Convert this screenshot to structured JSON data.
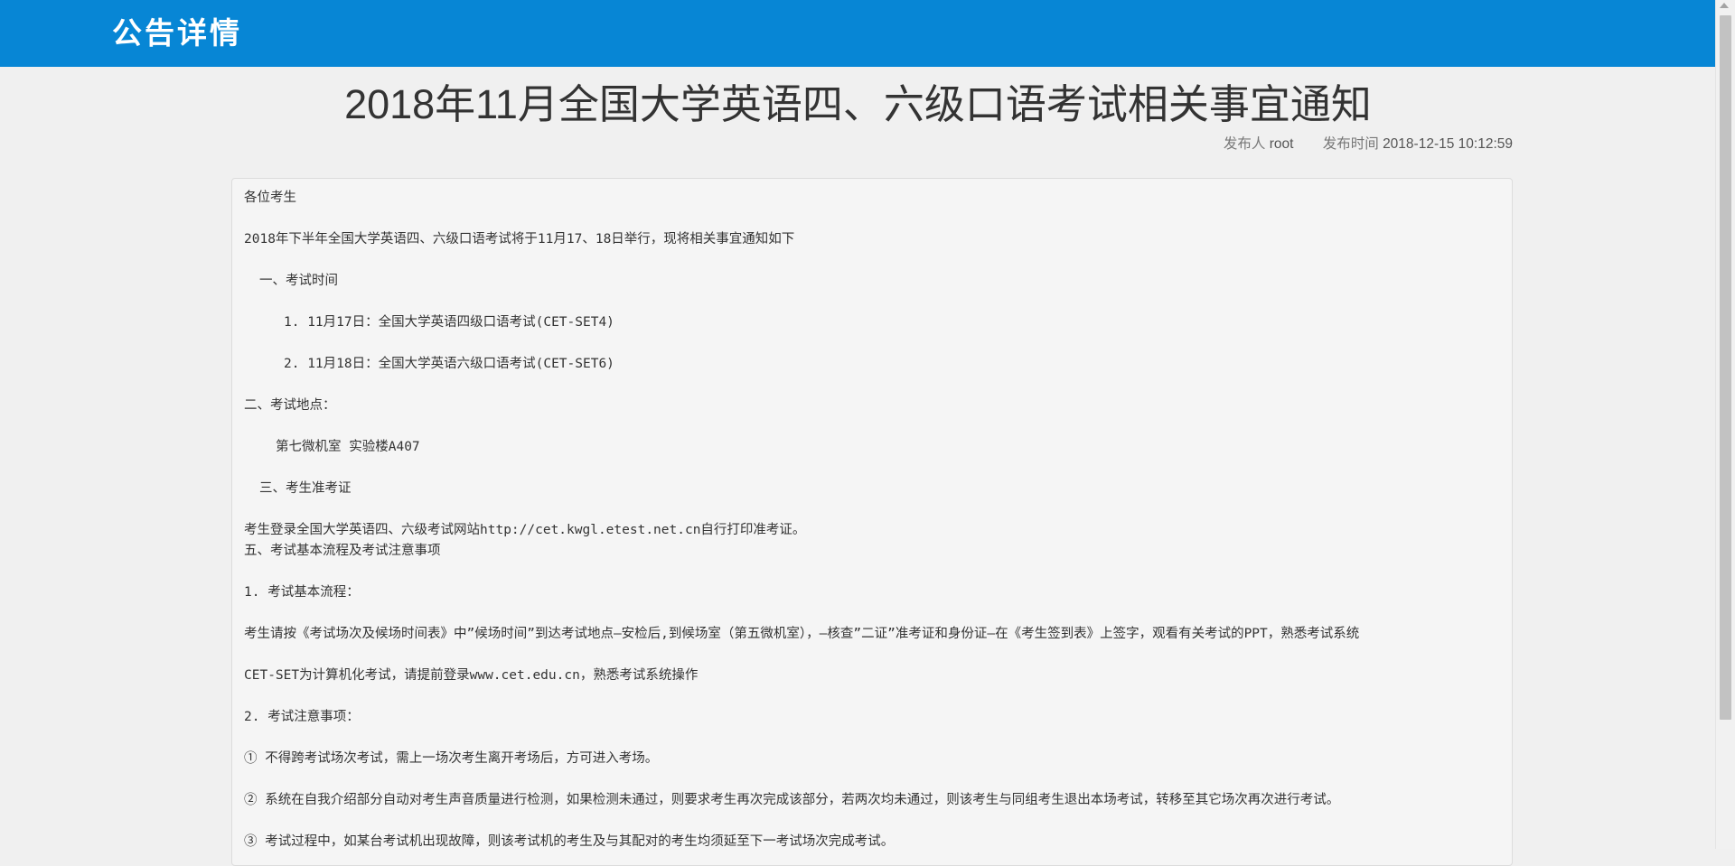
{
  "header": {
    "title": "公告详情"
  },
  "notice": {
    "title": "2018年11月全国大学英语四、六级口语考试相关事宜通知",
    "publisher_label": "发布人",
    "publisher": "root",
    "time_label": "发布时间",
    "time": "2018-12-15 10:12:59"
  },
  "content": {
    "greeting": "各位考生",
    "intro": "2018年下半年全国大学英语四、六级口语考试将于11月17、18日举行，现将相关事宜通知如下",
    "section1": "一、考试时间",
    "item1": "1.  11月17日：全国大学英语四级口语考试(CET-SET4)",
    "item2": "2.  11月18日：全国大学英语六级口语考试(CET-SET6)",
    "section2": "二、考试地点：",
    "location": "第七微机室 实验楼A407",
    "section3": "三、考生准考证",
    "admit": "考生登录全国大学英语四、六级考试网站http://cet.kwgl.etest.net.cn自行打印准考证。",
    "section5": "五、考试基本流程及考试注意事项",
    "flow_title": "1. 考试基本流程：",
    "flow_body": "考生请按《考试场次及候场时间表》中”候场时间”到达考试地点—安检后,到候场室（第五微机室），—核查”二证”准考证和身份证—在《考生签到表》上签字，观看有关考试的PPT，熟悉考试系统",
    "cet_note": "CET-SET为计算机化考试，请提前登录www.cet.edu.cn，熟悉考试系统操作",
    "notes_title": "2. 考试注意事项：",
    "note1": "① 不得跨考试场次考试，需上一场次考生离开考场后，方可进入考场。",
    "note2": "② 系统在自我介绍部分自动对考生声音质量进行检测，如果检测未通过，则要求考生再次完成该部分，若两次均未通过，则该考生与同组考生退出本场考试，转移至其它场次再次进行考试。",
    "note3": "③ 考试过程中，如某台考试机出现故障，则该考试机的考生及与其配对的考生均须延至下一考试场次完成考试。"
  }
}
